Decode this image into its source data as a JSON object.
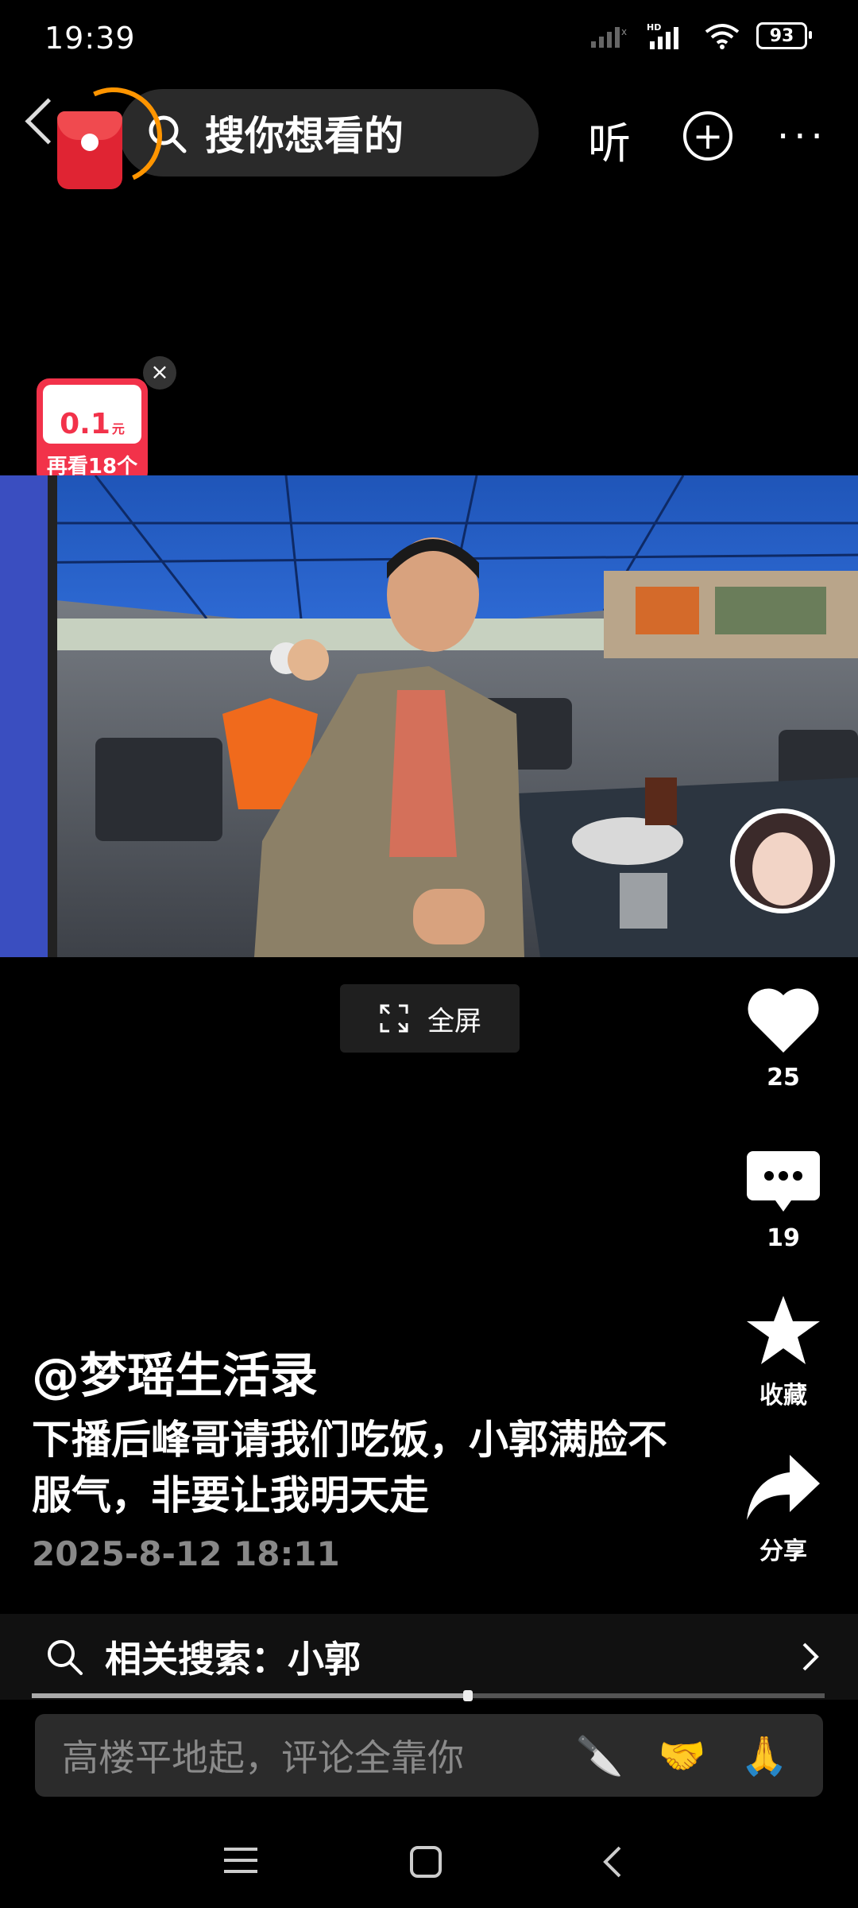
{
  "status": {
    "time": "19:39",
    "net": "HD",
    "battery": "93"
  },
  "topbar": {
    "search_placeholder": "搜你想看的",
    "listen": "听"
  },
  "coupon": {
    "amount": "0.1",
    "unit": "元",
    "label": "再看18个"
  },
  "video": {
    "fullscreen_label": "全屏"
  },
  "actions": {
    "likes": "25",
    "comments": "19",
    "favorite": "收藏",
    "share": "分享"
  },
  "post": {
    "author": "@梦瑶生活录",
    "caption": "下播后峰哥请我们吃饭，小郭满脸不服气，非要让我明天走",
    "date": "2025-8-12 18:11"
  },
  "related_search": {
    "label": "相关搜索：小郭"
  },
  "playback": {
    "progress": 0.55
  },
  "comment": {
    "placeholder": "高楼平地起，评论全靠你",
    "emojis": [
      "🔪",
      "🤝",
      "🙏"
    ]
  }
}
